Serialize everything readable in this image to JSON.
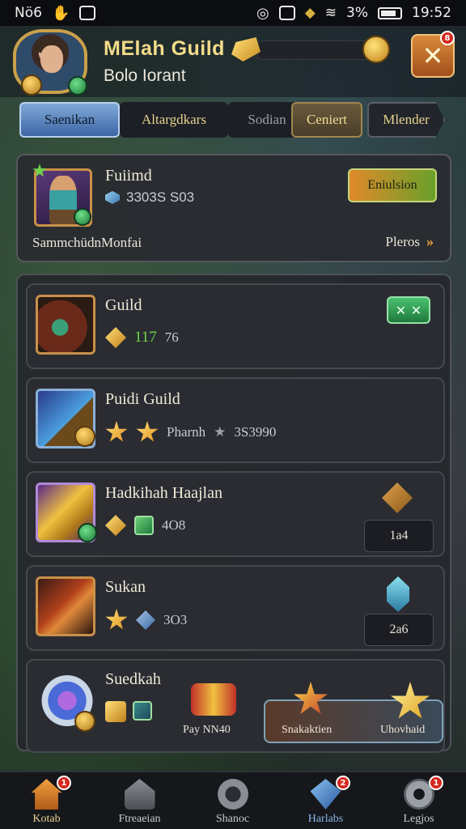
{
  "status_bar": {
    "carrier": "Nö6",
    "battery_pct": "3%",
    "time": "19:52"
  },
  "header": {
    "title": "MElah Guild",
    "subtitle": "Bolo Iorant",
    "close_symbol": "✕",
    "close_notif": "8"
  },
  "tabs": [
    {
      "label": "Saenikan"
    },
    {
      "label": "Altargdkars"
    },
    {
      "label": "Sodian"
    },
    {
      "label": "Ceniert"
    },
    {
      "label": "Mlender"
    }
  ],
  "profile": {
    "name": "Fuiimd",
    "value": "3303S S03",
    "subtitle": "SammchüdnMonfai",
    "more_label": "Pleros",
    "action_label": "Eniulsion"
  },
  "rows": [
    {
      "title": "Guild",
      "meta": [
        "117",
        "76"
      ],
      "action": "✕ ✕"
    },
    {
      "title": "Puidi Guild",
      "meta": [
        "Pharnh",
        "3S3990"
      ]
    },
    {
      "title": "Hadkihah Haajlan",
      "meta": [
        "4O8"
      ],
      "side": "1a4"
    },
    {
      "title": "Sukan",
      "meta": [
        "3O3"
      ],
      "side": "2a6"
    },
    {
      "title": "Suedkah",
      "reward_caption": "Pay NN40",
      "reward_left": "Snakaktien",
      "reward_right": "Uhovhaid"
    }
  ],
  "bottom_nav": [
    {
      "label": "Kotab",
      "icon": "home-icon",
      "badge": "1"
    },
    {
      "label": "Ftreaeian",
      "icon": "castle-icon"
    },
    {
      "label": "Shanoc",
      "icon": "shield-icon"
    },
    {
      "label": "Harlabs",
      "icon": "gem-icon",
      "badge": "2"
    },
    {
      "label": "Legjos",
      "icon": "gear-icon",
      "badge": "1"
    }
  ],
  "colors": {
    "accent_gold": "#e8d28d",
    "tab_active": "#3e66a4",
    "close_orange": "#d98a3a",
    "success_green": "#4ac070",
    "badge_red": "#d4281e"
  }
}
